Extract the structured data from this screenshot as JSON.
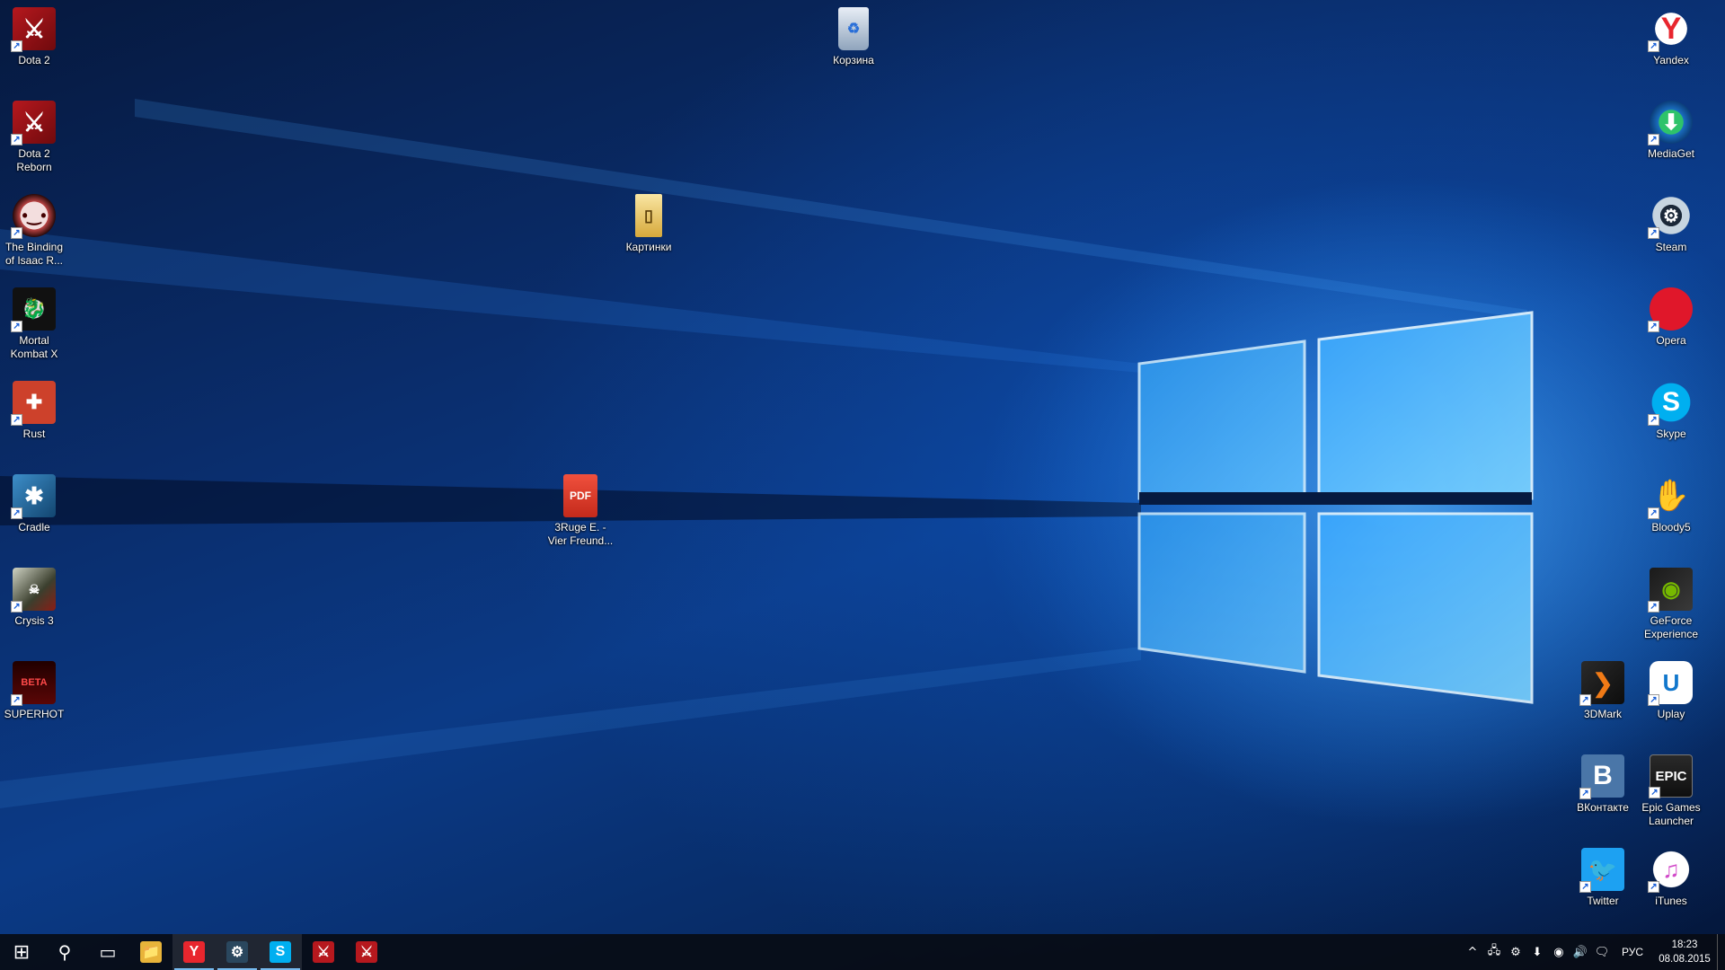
{
  "desktop": {
    "icons": [
      {
        "name": "dota-2-icon",
        "label": "Dota 2",
        "glyph": "⚔",
        "style": "i-dota",
        "shortcut": true
      },
      {
        "name": "dota-2-reborn-icon",
        "label": "Dota 2 Reborn",
        "glyph": "⚔",
        "style": "i-dota",
        "shortcut": true
      },
      {
        "name": "binding-of-isaac-icon",
        "label": "The Binding of Isaac R...",
        "glyph": "•‿•",
        "style": "i-isaac",
        "shortcut": true
      },
      {
        "name": "mortal-kombat-x-icon",
        "label": "Mortal Kombat X",
        "glyph": "🐉",
        "style": "i-mk",
        "shortcut": true
      },
      {
        "name": "rust-icon",
        "label": "Rust",
        "glyph": "✚",
        "style": "i-rust",
        "shortcut": true
      },
      {
        "name": "cradle-icon",
        "label": "Cradle",
        "glyph": "✱",
        "style": "i-cradle",
        "shortcut": true
      },
      {
        "name": "crysis-3-icon",
        "label": "Crysis 3",
        "glyph": "☠",
        "style": "i-crysis",
        "shortcut": true
      },
      {
        "name": "superhot-icon",
        "label": "SUPERHOT",
        "glyph": "BETA",
        "style": "i-superhot",
        "shortcut": true
      },
      {
        "name": "recycle-bin-icon",
        "label": "Корзина",
        "glyph": "♻",
        "style": "i-bin",
        "shortcut": false
      },
      {
        "name": "pictures-folder-icon",
        "label": "Картинки",
        "glyph": "▯",
        "style": "i-folder",
        "shortcut": false
      },
      {
        "name": "pdf-file-icon",
        "label": "3Ruge E. - Vier Freund...",
        "glyph": "PDF",
        "style": "i-pdf",
        "shortcut": false
      },
      {
        "name": "yandex-browser-icon",
        "label": "Yandex",
        "glyph": "Y",
        "style": "i-yandex",
        "shortcut": true
      },
      {
        "name": "mediaget-icon",
        "label": "MediaGet",
        "glyph": "⬇",
        "style": "i-mediaget",
        "shortcut": true
      },
      {
        "name": "steam-icon",
        "label": "Steam",
        "glyph": "⚙",
        "style": "i-steam",
        "shortcut": true
      },
      {
        "name": "opera-icon",
        "label": "Opera",
        "glyph": "O",
        "style": "i-opera",
        "shortcut": true
      },
      {
        "name": "skype-icon",
        "label": "Skype",
        "glyph": "S",
        "style": "i-skype",
        "shortcut": true
      },
      {
        "name": "bloody5-icon",
        "label": "Bloody5",
        "glyph": "✋",
        "style": "i-bloody",
        "shortcut": true
      },
      {
        "name": "geforce-experience-icon",
        "label": "GeForce Experience",
        "glyph": "◉",
        "style": "i-geforce",
        "shortcut": true
      },
      {
        "name": "3dmark-icon",
        "label": "3DMark",
        "glyph": "❯",
        "style": "i-3dmark",
        "shortcut": true
      },
      {
        "name": "uplay-icon",
        "label": "Uplay",
        "glyph": "U",
        "style": "i-uplay",
        "shortcut": true
      },
      {
        "name": "vkontakte-icon",
        "label": "ВКонтакте",
        "glyph": "B",
        "style": "i-vk",
        "shortcut": true
      },
      {
        "name": "epic-games-launcher-icon",
        "label": "Epic Games Launcher",
        "glyph": "EPIC",
        "style": "i-epic",
        "shortcut": true
      },
      {
        "name": "twitter-icon",
        "label": "Twitter",
        "glyph": "🐦",
        "style": "i-twitter",
        "shortcut": true
      },
      {
        "name": "itunes-icon",
        "label": "iTunes",
        "glyph": "♫",
        "style": "i-itunes",
        "shortcut": true
      }
    ]
  },
  "taskbar": {
    "start_glyph": "⊞",
    "search_glyph": "⚲",
    "task_view_glyph": "▭",
    "pinned": [
      {
        "name": "taskbar-file-explorer",
        "glyph": "📁",
        "color": "#e8b43a",
        "active": false
      },
      {
        "name": "taskbar-yandex-browser",
        "glyph": "Y",
        "color": "#e8262e",
        "active": true
      },
      {
        "name": "taskbar-steam",
        "glyph": "⚙",
        "color": "#2a475e",
        "active": true
      },
      {
        "name": "taskbar-skype",
        "glyph": "S",
        "color": "#00aff0",
        "active": true
      },
      {
        "name": "taskbar-dota-2",
        "glyph": "⚔",
        "color": "#b6181e",
        "active": false
      },
      {
        "name": "taskbar-dota-2-reborn",
        "glyph": "⚔",
        "color": "#b6181e",
        "active": false
      }
    ],
    "tray": {
      "icons": [
        {
          "name": "show-hidden-icons-chevron",
          "glyph": "^"
        },
        {
          "name": "network-icon",
          "glyph": "🖧"
        },
        {
          "name": "steam-tray-icon",
          "glyph": "⚙"
        },
        {
          "name": "mediaget-tray-icon",
          "glyph": "⬇"
        },
        {
          "name": "geforce-tray-icon",
          "glyph": "◉"
        },
        {
          "name": "volume-icon",
          "glyph": "🔊"
        },
        {
          "name": "action-center-icon",
          "glyph": "🗨"
        }
      ],
      "language": "РУС",
      "time": "18:23",
      "date": "08.08.2015"
    }
  }
}
